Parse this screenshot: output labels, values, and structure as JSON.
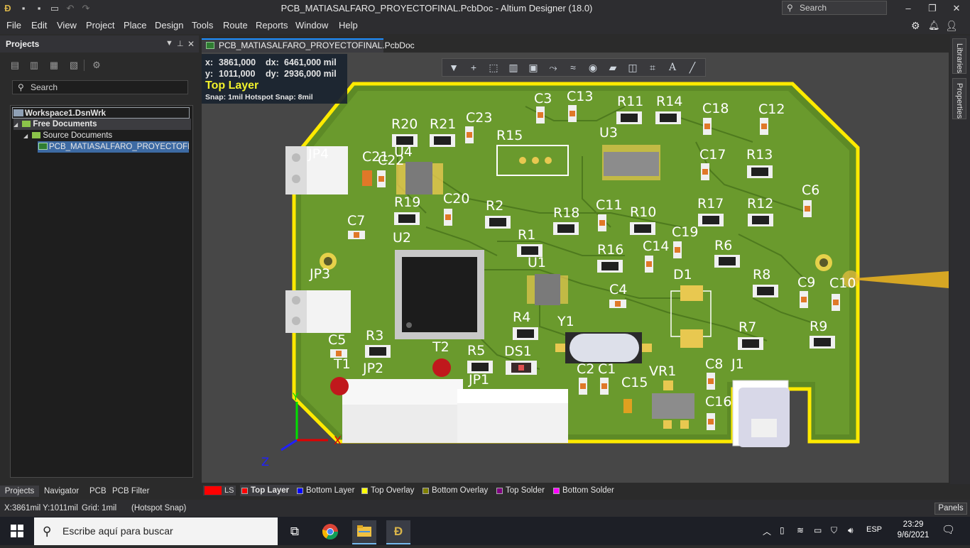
{
  "window": {
    "title": "PCB_MATIASALFARO_PROYECTOFINAL.PcbDoc - Altium Designer (18.0)",
    "search_placeholder": "Search"
  },
  "menu": [
    "File",
    "Edit",
    "View",
    "Project",
    "Place",
    "Design",
    "Tools",
    "Route",
    "Reports",
    "Window",
    "Help"
  ],
  "projects_panel": {
    "title": "Projects",
    "search_placeholder": "Search",
    "tree": [
      {
        "label": "Workspace1.DsnWrk",
        "level": 0,
        "bold": true
      },
      {
        "label": "Free Documents",
        "level": 1,
        "bold": true
      },
      {
        "label": "Source Documents",
        "level": 2,
        "bold": false
      },
      {
        "label": "PCB_MATIASALFARO_PROYECTOFINAL.PcbDoc",
        "level": 3,
        "bold": false,
        "selected": true
      }
    ],
    "bottom_tabs": [
      "Projects",
      "Navigator",
      "PCB",
      "PCB Filter"
    ]
  },
  "document_tab": {
    "label": "PCB_MATIASALFARO_PROYECTOFINAL.PcbDoc"
  },
  "right_dock": {
    "tabs": [
      "Libraries",
      "Properties"
    ]
  },
  "hud": {
    "x_label": "x:",
    "x_value": "3861,000",
    "dx_label": "dx:",
    "dx_value": "6461,000 mil",
    "y_label": "y:",
    "y_value": "1011,000",
    "dy_label": "dy:",
    "dy_value": "2936,000 mil",
    "layer": "Top Layer",
    "snap": "Snap: 1mil Hotspot Snap: 8mil"
  },
  "floating_toolbar": {
    "icons": [
      "filter-icon",
      "add-cross-icon",
      "select-rect-icon",
      "bar-chart-icon",
      "chip-icon",
      "route-icon",
      "diff-pair-icon",
      "via-icon",
      "polygon-icon",
      "board-icon",
      "graph-icon",
      "text-icon",
      "line-icon"
    ]
  },
  "pcb": {
    "designators": {
      "JP4": "JP4",
      "C21": "C21",
      "C22": "C22",
      "U4": "U4",
      "R20": "R20",
      "R21": "R21",
      "C23": "C23",
      "R15": "R15",
      "C3": "C3",
      "C13": "C13",
      "R11": "R11",
      "R14": "R14",
      "U3": "U3",
      "C18": "C18",
      "C12": "C12",
      "C17": "C17",
      "R13": "R13",
      "C6": "C6",
      "R19": "R19",
      "C20": "C20",
      "C7": "C7",
      "R2": "R2",
      "R18": "R18",
      "C11": "C11",
      "R10": "R10",
      "R17": "R17",
      "R12": "R12",
      "U2": "U2",
      "R1": "R1",
      "C19": "C19",
      "R16": "R16",
      "C14": "C14",
      "R6": "R6",
      "JP3": "JP3",
      "U1": "U1",
      "D1": "D1",
      "R8": "R8",
      "C9": "C9",
      "C10": "C10",
      "C4": "C4",
      "R4": "R4",
      "Y1": "Y1",
      "R7": "R7",
      "R9": "R9",
      "C5": "C5",
      "R3": "R3",
      "T2": "T2",
      "R5": "R5",
      "DS1": "DS1",
      "T1": "T1",
      "JP2": "JP2",
      "C2": "C2",
      "C1": "C1",
      "VR1": "VR1",
      "C8": "C8",
      "J1": "J1",
      "C15": "C15",
      "JP1": "JP1",
      "C16": "C16"
    },
    "axis": {
      "x": "X",
      "y": "Y",
      "z": "Z"
    }
  },
  "layers": {
    "ls_label": "LS",
    "items": [
      {
        "label": "Top Layer",
        "color": "#ff0000",
        "active": true
      },
      {
        "label": "Bottom Layer",
        "color": "#0000ff"
      },
      {
        "label": "Top Overlay",
        "color": "#ffff00"
      },
      {
        "label": "Bottom Overlay",
        "color": "#808000"
      },
      {
        "label": "Top Solder",
        "color": "#800080"
      },
      {
        "label": "Bottom Solder",
        "color": "#ff00ff"
      }
    ]
  },
  "status": {
    "coords": "X:3861mil Y:1011mil",
    "grid": "Grid: 1mil",
    "snap": "(Hotspot Snap)",
    "panels": "Panels"
  },
  "taskbar": {
    "search_placeholder": "Escribe aquí para buscar",
    "lang": "ESP",
    "time": "23:29",
    "date": "9/6/2021"
  }
}
